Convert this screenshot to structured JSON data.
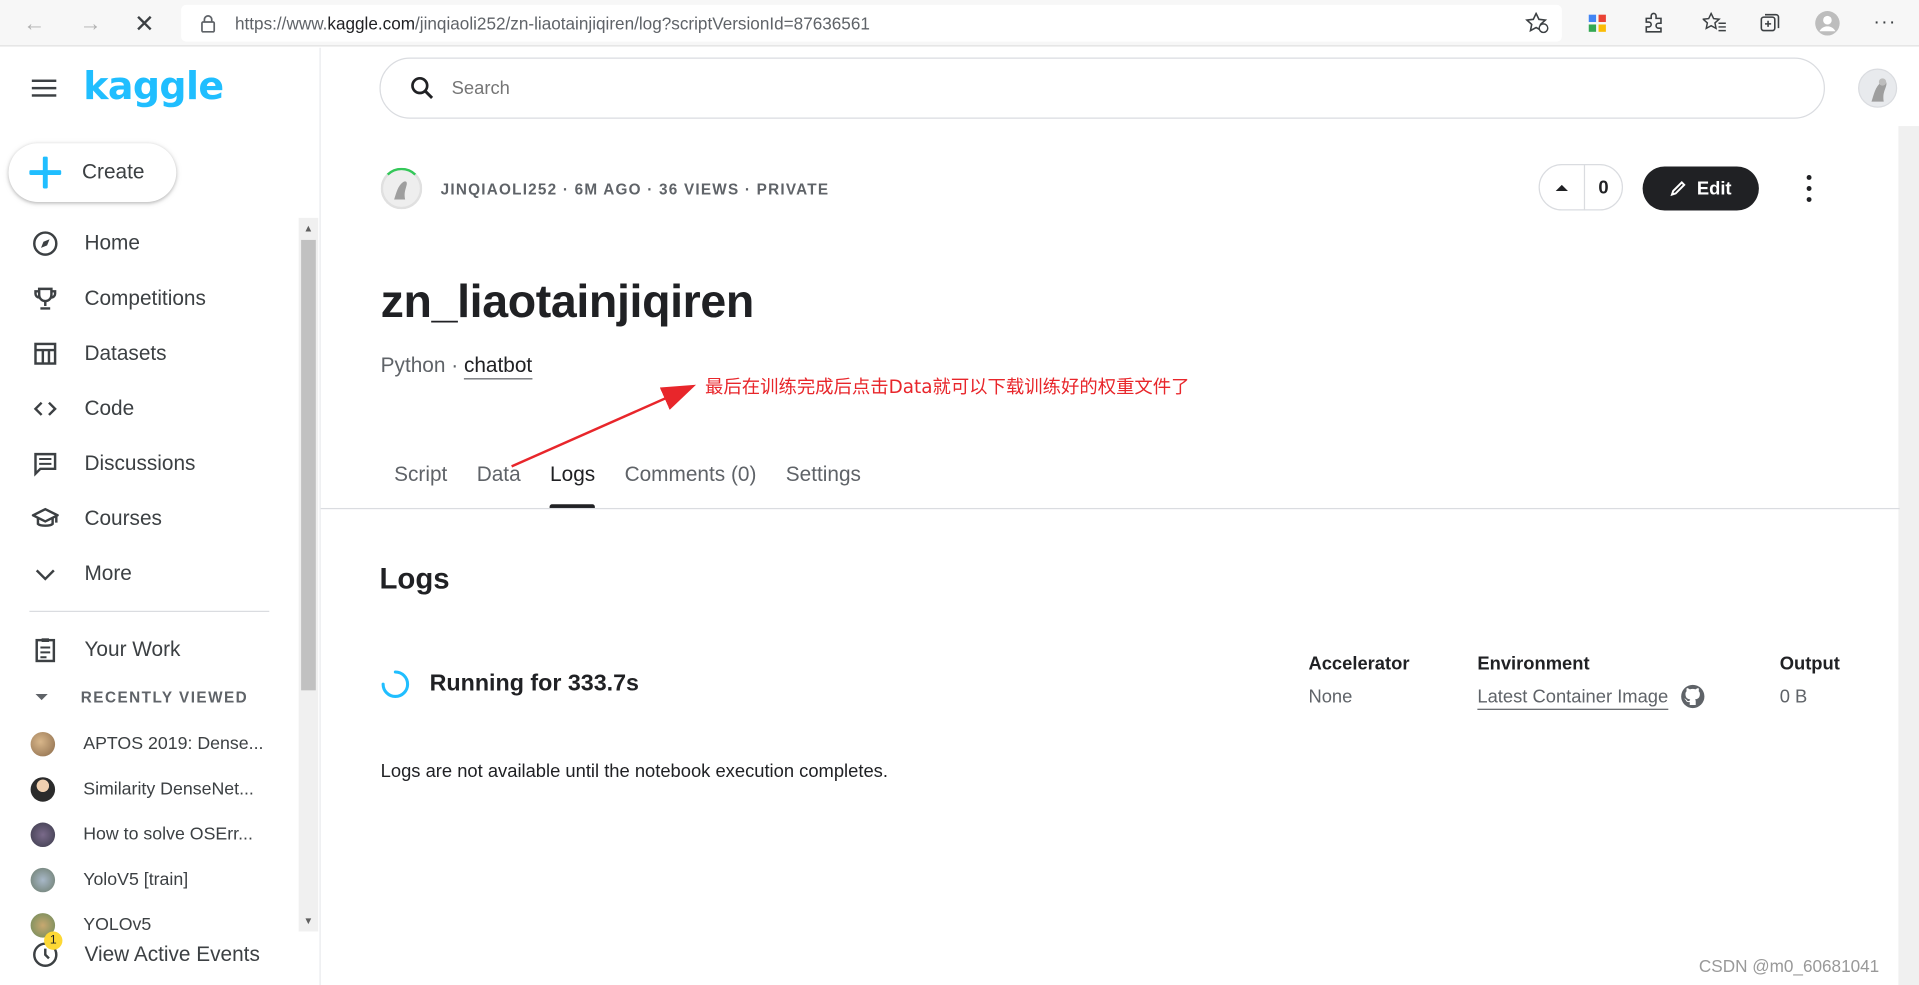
{
  "browser": {
    "url_prefix": "https://www.",
    "url_domain": "kaggle.com",
    "url_path": "/jinqiaoli252/zn-liaotainjiqiren/log?scriptVersionId=87636561"
  },
  "sidebar": {
    "logo": "kaggle",
    "create_label": "Create",
    "items": [
      {
        "label": "Home",
        "icon": "compass-icon"
      },
      {
        "label": "Competitions",
        "icon": "trophy-icon"
      },
      {
        "label": "Datasets",
        "icon": "table-icon"
      },
      {
        "label": "Code",
        "icon": "code-icon"
      },
      {
        "label": "Discussions",
        "icon": "comments-icon"
      },
      {
        "label": "Courses",
        "icon": "school-icon"
      },
      {
        "label": "More",
        "icon": "chevron-down-icon"
      }
    ],
    "your_work": "Your Work",
    "recently_viewed": "RECENTLY VIEWED",
    "recent": [
      "APTOS 2019: Dense...",
      "Similarity DenseNet...",
      "How to solve OSErr...",
      "YoloV5 [train]",
      "YOLOv5"
    ],
    "events_label": "View Active Events",
    "events_badge": "1"
  },
  "header": {
    "search_placeholder": "Search"
  },
  "notebook": {
    "meta": "JINQIAOLI252 · 6M AGO · 36 VIEWS · PRIVATE",
    "votes": "0",
    "edit_label": "Edit",
    "title": "zn_liaotainjiqiren",
    "language": "Python · ",
    "tag": "chatbot",
    "annotation": "最后在训练完成后点击Data就可以下载训练好的权重文件了",
    "tabs": [
      "Script",
      "Data",
      "Logs",
      "Comments (0)",
      "Settings"
    ],
    "active_tab": "Logs"
  },
  "logs": {
    "heading": "Logs",
    "status": "Running for 333.7s",
    "accelerator_label": "Accelerator",
    "accelerator_value": "None",
    "environment_label": "Environment",
    "environment_value": "Latest Container Image",
    "output_label": "Output",
    "output_value": "0 B",
    "note": "Logs are not available until the notebook execution completes."
  },
  "watermark": "CSDN @m0_60681041",
  "colors": {
    "brand": "#20beff",
    "annotation": "#e8262b",
    "dark": "#202124"
  }
}
